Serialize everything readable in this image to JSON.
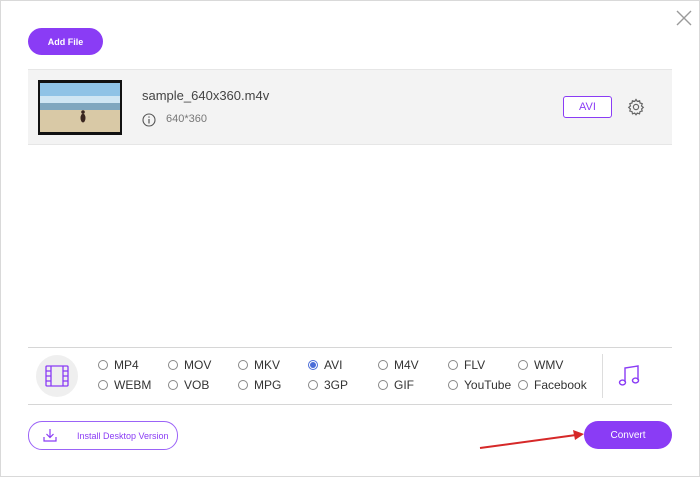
{
  "toolbar": {
    "add_file_label": "Add File"
  },
  "file": {
    "name": "sample_640x360.m4v",
    "resolution": "640*360",
    "output_format": "AVI"
  },
  "formats": {
    "row1": [
      "MP4",
      "MOV",
      "MKV",
      "AVI",
      "M4V",
      "FLV",
      "WMV"
    ],
    "row2": [
      "WEBM",
      "VOB",
      "MPG",
      "3GP",
      "GIF",
      "YouTube",
      "Facebook"
    ],
    "selected": "AVI"
  },
  "footer": {
    "install_label": "Install Desktop Version",
    "convert_label": "Convert"
  },
  "colors": {
    "accent": "#8a3cf5",
    "radio_selected": "#4a6dd8",
    "annotation_arrow": "#d62828"
  },
  "icons": [
    "close-icon",
    "info-icon",
    "gear-icon",
    "video-film-icon",
    "music-note-icon",
    "download-icon"
  ]
}
